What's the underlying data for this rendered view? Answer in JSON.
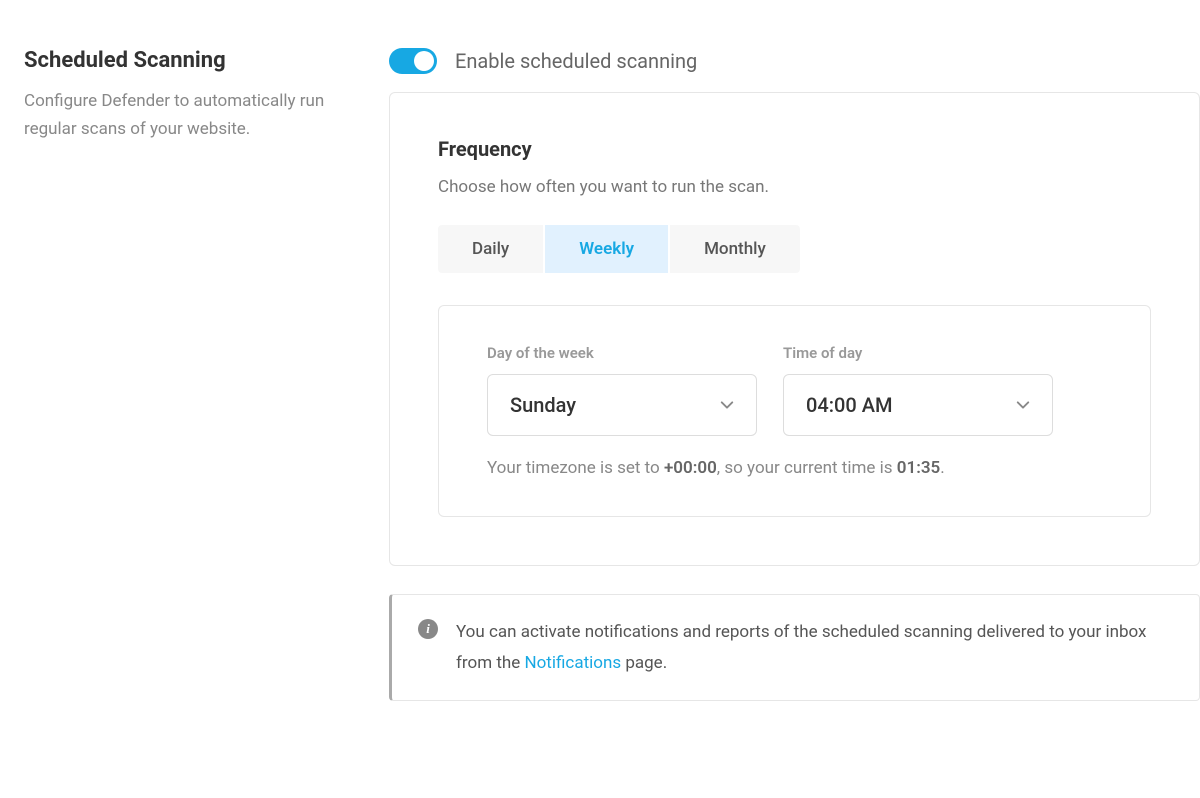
{
  "left": {
    "title": "Scheduled Scanning",
    "desc": "Configure Defender to automatically run regular scans of your website."
  },
  "toggle": {
    "label": "Enable scheduled scanning",
    "enabled": true
  },
  "frequency": {
    "title": "Frequency",
    "sub": "Choose how often you want to run the scan.",
    "tabs": {
      "daily": "Daily",
      "weekly": "Weekly",
      "monthly": "Monthly"
    },
    "day_label": "Day of the week",
    "day_value": "Sunday",
    "time_label": "Time of day",
    "time_value": "04:00 AM",
    "tz_pre": "Your timezone is set to ",
    "tz_value": "+00:00",
    "tz_mid": ", so your current time is ",
    "tz_time": "01:35",
    "tz_post": "."
  },
  "notice": {
    "text_pre": "You can activate notifications and reports of the scheduled scanning delivered to your inbox from the ",
    "link": "Notifications",
    "text_post": " page."
  }
}
